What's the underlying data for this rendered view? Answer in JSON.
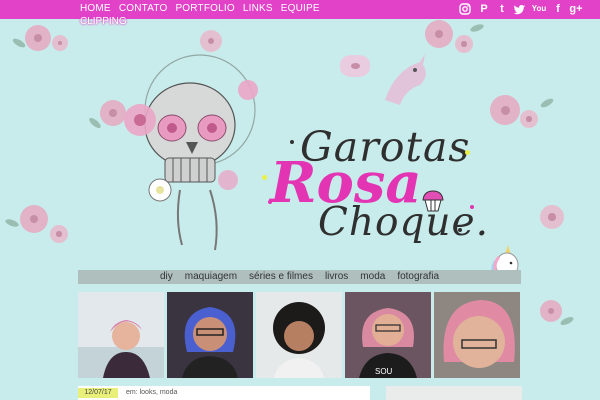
{
  "nav": {
    "items": [
      "HOME",
      "CONTATO",
      "PORTFOLIO",
      "LINKS",
      "EQUIPE"
    ],
    "clipping": "CLIPPING"
  },
  "social": {
    "instagram": "instagram-icon",
    "pinterest": "P",
    "tumblr": "t",
    "twitter": "twitter-icon",
    "youtube": "You",
    "facebook": "f",
    "googleplus": "g+"
  },
  "logo": {
    "line1": "Garotas",
    "line2": "Rosa",
    "line3": "Choque."
  },
  "categories": [
    "diy",
    "maquiagem",
    "séries e filmes",
    "livros",
    "moda",
    "fotografia"
  ],
  "post": {
    "date": "12/07/17",
    "category": "em: looks, moda"
  },
  "colors": {
    "nav_bg": "#e142c8",
    "accent_pink": "#e335b3",
    "background": "#c8ecec",
    "date_badge": "#e8f07a"
  }
}
